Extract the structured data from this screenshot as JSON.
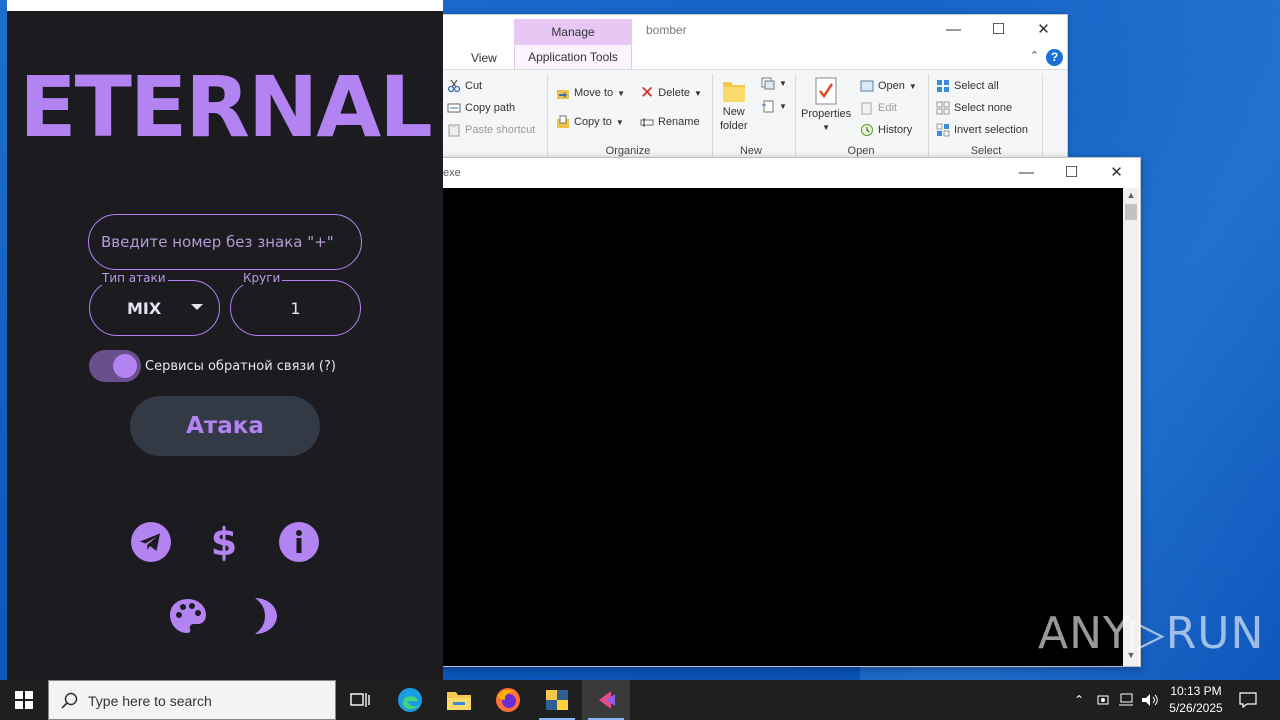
{
  "explorer": {
    "title": "bomber",
    "context_tab": "Manage",
    "tab_view": "View",
    "tab_app_tools": "Application Tools",
    "clipboard": {
      "cut": "Cut",
      "copy_path": "Copy path",
      "paste_shortcut": "Paste shortcut"
    },
    "organize": {
      "move_to": "Move to",
      "copy_to": "Copy to",
      "delete": "Delete",
      "rename": "Rename",
      "group": "Organize"
    },
    "new": {
      "new_folder_line1": "New",
      "new_folder_line2": "folder",
      "group": "New"
    },
    "open": {
      "properties": "Properties",
      "open": "Open",
      "edit": "Edit",
      "history": "History",
      "group": "Open"
    },
    "select": {
      "select_all": "Select all",
      "select_none": "Select none",
      "invert": "Invert selection",
      "group": "Select"
    }
  },
  "console": {
    "title": "exe"
  },
  "app": {
    "logo": "ETERNAL",
    "phone_placeholder": "Введите номер без знака \"+\"",
    "attack_type_label": "Тип атаки",
    "attack_type_value": "MIX",
    "rounds_label": "Круги",
    "rounds_value": "1",
    "feedback_toggle_label": "Сервисы обратной связи (?)",
    "feedback_toggle_on": true,
    "attack_button": "Атака",
    "accent_color": "#b383f2",
    "background_color": "#1c1b20",
    "icons": [
      "telegram-icon",
      "dollar-icon",
      "info-icon",
      "palette-icon",
      "moon-icon"
    ]
  },
  "taskbar": {
    "search_placeholder": "Type here to search",
    "time": "10:13 PM",
    "date": "5/26/2025",
    "apps": [
      "task-view-icon",
      "edge-icon",
      "file-explorer-icon",
      "firefox-icon",
      "python-icon",
      "eternal-app-icon"
    ]
  },
  "watermark": "ANY▷RUN"
}
